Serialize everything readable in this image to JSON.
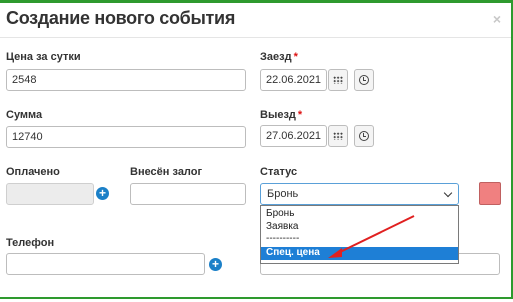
{
  "dialog": {
    "title": "Создание нового события",
    "close_glyph": "×"
  },
  "fields": {
    "price_per_day": {
      "label": "Цена за сутки",
      "value": "2548"
    },
    "total": {
      "label": "Сумма",
      "value": "12740"
    },
    "paid": {
      "label": "Оплачено",
      "value": ""
    },
    "deposit": {
      "label": "Внесён залог",
      "value": ""
    },
    "phone": {
      "label": "Телефон",
      "value": ""
    },
    "checkin": {
      "label": "Заезд",
      "required_mark": "*",
      "value": "22.06.2021"
    },
    "checkout": {
      "label": "Выезд",
      "required_mark": "*",
      "value": "27.06.2021"
    },
    "status": {
      "label": "Статус",
      "selected": "Бронь",
      "options": [
        "Бронь",
        "Заявка",
        "----------",
        "Спец. цена"
      ],
      "highlighted_option": "Спец. цена"
    },
    "plus_glyph": "+"
  },
  "icons": {
    "calendar": "calendar-icon",
    "clock": "clock-icon",
    "add": "plus-circle-icon"
  },
  "colors": {
    "frame_border": "#2e9a2e",
    "status_color_swatch": "#f08080",
    "option_highlight": "#1e7fd6",
    "annotation_arrow": "#e02020",
    "add_button": "#1b80c8"
  }
}
